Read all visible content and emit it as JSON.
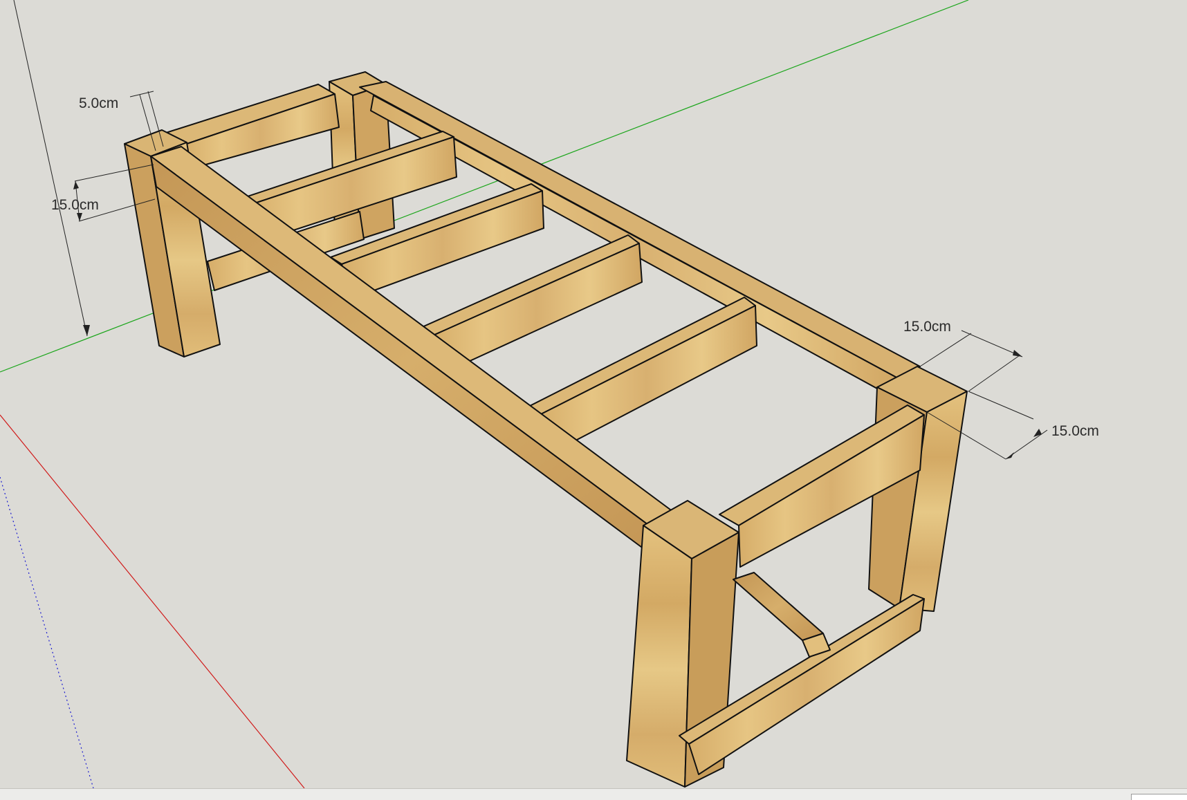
{
  "viewport": {
    "background": "#dcdbd6",
    "axes": {
      "green": "#1aa51a",
      "red": "#d01a1a",
      "blue": "#1a1ad0"
    }
  },
  "model": {
    "wood_light": "#e3c07e",
    "wood_mid": "#d4ab66",
    "wood_dark": "#b98d4c",
    "edge": "#111111"
  },
  "dimensions": {
    "post_thickness": "5.0cm",
    "rail_height": "15.0cm",
    "leg_width": "15.0cm",
    "leg_depth": "15.0cm"
  }
}
